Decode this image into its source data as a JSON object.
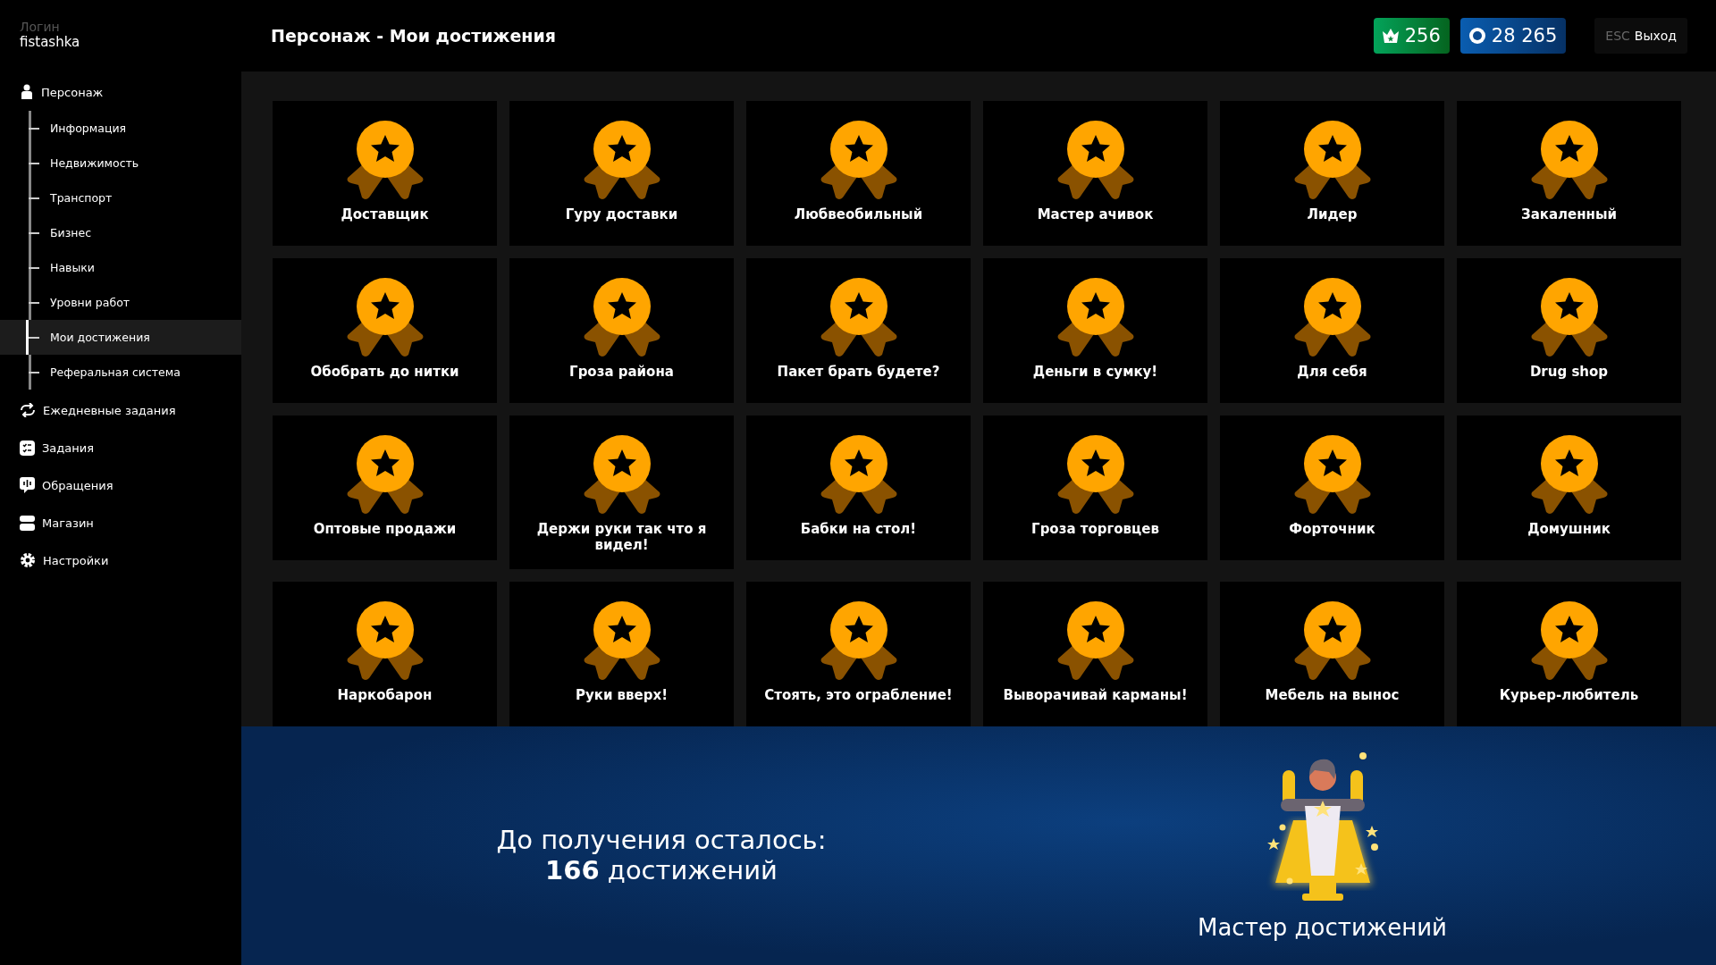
{
  "sidebar": {
    "login_label": "Логин",
    "username": "fistashka",
    "items": [
      {
        "label": "Персонаж",
        "children": [
          {
            "label": "Информация",
            "selected": false
          },
          {
            "label": "Недвижимость",
            "selected": false
          },
          {
            "label": "Транспорт",
            "selected": false
          },
          {
            "label": "Бизнес",
            "selected": false
          },
          {
            "label": "Навыки",
            "selected": false
          },
          {
            "label": "Уровни работ",
            "selected": false
          },
          {
            "label": "Мои достижения",
            "selected": true
          },
          {
            "label": "Реферальная система",
            "selected": false
          }
        ]
      },
      {
        "label": "Ежедневные задания"
      },
      {
        "label": "Задания"
      },
      {
        "label": "Обращения"
      },
      {
        "label": "Магазин"
      },
      {
        "label": "Настройки"
      }
    ]
  },
  "header": {
    "title": "Персонаж - Мои достижения",
    "donate": "256",
    "money": "28 265",
    "exit_key": "ESC",
    "exit_label": "Выход"
  },
  "achievements": [
    {
      "title": "Доставщик"
    },
    {
      "title": "Гуру доставки"
    },
    {
      "title": "Любвеобильный"
    },
    {
      "title": "Мастер ачивок"
    },
    {
      "title": "Лидер"
    },
    {
      "title": "Закаленный"
    },
    {
      "title": "Обобрать до нитки"
    },
    {
      "title": "Гроза района"
    },
    {
      "title": "Пакет брать будете?"
    },
    {
      "title": "Деньги в сумку!"
    },
    {
      "title": "Для себя"
    },
    {
      "title": "Drug shop"
    },
    {
      "title": "Оптовые продажи"
    },
    {
      "title": "Держи руки так что я видел!"
    },
    {
      "title": "Бабки на стол!"
    },
    {
      "title": "Гроза торговцев"
    },
    {
      "title": "Форточник"
    },
    {
      "title": "Домушник"
    },
    {
      "title": "Наркобарон"
    },
    {
      "title": "Руки вверх!"
    },
    {
      "title": "Стоять, это ограбление!"
    },
    {
      "title": "Выворачивай карманы!"
    },
    {
      "title": "Мебель на вынос"
    },
    {
      "title": "Курьер-любитель"
    }
  ],
  "banner": {
    "line1": "До получения осталось:",
    "line2": "**166** достижений",
    "reward_title": "Мастер достижений"
  }
}
